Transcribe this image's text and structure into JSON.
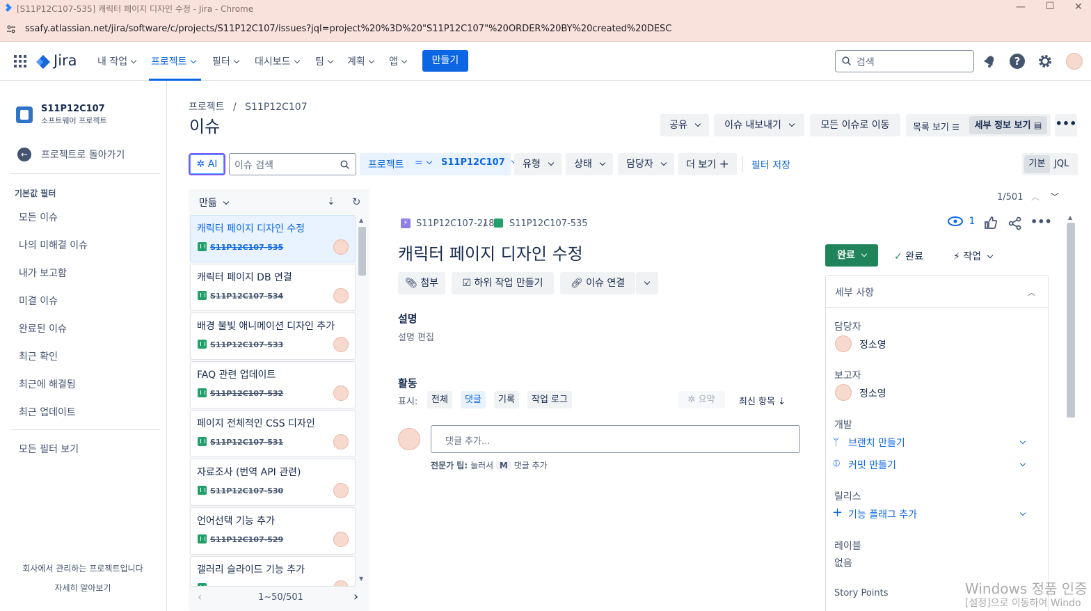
{
  "browser": {
    "title": "[S11P12C107-535] 캐릭터 페이지 디자인 수정 - Jira - Chrome",
    "url": "ssafy.atlassian.net/jira/software/c/projects/S11P12C107/issues?jql=project%20%3D%20\"S11P12C107\"%20ORDER%20BY%20created%20DESC"
  },
  "topnav": {
    "logo": "Jira",
    "items": [
      "내 작업",
      "프로젝트",
      "필터",
      "대시보드",
      "팀",
      "계획",
      "앱"
    ],
    "create": "만들기",
    "search_placeholder": "검색"
  },
  "sidebar": {
    "project_name": "S11P12C107",
    "project_type": "소프트웨어 프로젝트",
    "back": "프로젝트로 돌아가기",
    "filters_heading": "기본값 필터",
    "filters": [
      "모든 이슈",
      "나의 미해결 이슈",
      "내가 보고함",
      "미결 이슈",
      "완료된 이슈",
      "최근 확인",
      "최근에 해결됨",
      "최근 업데이트"
    ],
    "all_filters": "모든 필터 보기",
    "footer_note": "회사에서 관리하는 프로젝트입니다",
    "footer_link": "자세히 알아보기"
  },
  "header": {
    "breadcrumb_root": "프로젝트",
    "breadcrumb_sep": "/",
    "breadcrumb_project": "S11P12C107",
    "title": "이슈",
    "share": "공유",
    "export": "이슈 내보내기",
    "goto_all": "모든 이슈로 이동",
    "list_view": "목록 보기",
    "detail_view": "세부 정보 보기"
  },
  "filterbar": {
    "ai": "AI",
    "search_placeholder": "이슈 검색",
    "project_label": "프로젝트",
    "operator": "=",
    "project_value": "S11P12C107",
    "type": "유형",
    "status": "상태",
    "assignee": "담당자",
    "more": "더 보기",
    "save": "필터 저장",
    "basic": "기본",
    "jql": "JQL"
  },
  "list": {
    "sort_label": "만듦",
    "pagination": "1~50/501",
    "items": [
      {
        "title": "캐릭터 페이지 디자인 수정",
        "key": "S11P12C107-535"
      },
      {
        "title": "캐릭터 페이지 DB 연결",
        "key": "S11P12C107-534"
      },
      {
        "title": "배경 불빛 애니메이션 디자인 추가",
        "key": "S11P12C107-533"
      },
      {
        "title": "FAQ 관련 업데이트",
        "key": "S11P12C107-532"
      },
      {
        "title": "페이지 전체적인 CSS 디자인",
        "key": "S11P12C107-531"
      },
      {
        "title": "자료조사 (번역 API 관련)",
        "key": "S11P12C107-530"
      },
      {
        "title": "언어선택 기능 추가",
        "key": "S11P12C107-529"
      },
      {
        "title": "갤러리 슬라이드 기능 추가",
        "key": ""
      }
    ]
  },
  "detail": {
    "counter": "1/501",
    "parent_key": "S11P12C107-218",
    "issue_key": "S11P12C107-535",
    "watchers": "1",
    "title": "캐릭터 페이지 디자인 수정",
    "attach": "첨부",
    "subtask": "하위 작업 만들기",
    "link_issue": "이슈 연결",
    "desc_heading": "설명",
    "desc_edit": "설명 편집",
    "activity_heading": "활동",
    "show_label": "표시:",
    "act_all": "전체",
    "act_comments": "댓글",
    "act_history": "기록",
    "act_worklog": "작업 로그",
    "summarize": "요약",
    "newest": "최신 항목",
    "comment_placeholder": "댓글 추가...",
    "tip_prefix": "전문가 팁:",
    "tip_middle": "눌러서",
    "tip_key": "M",
    "tip_suffix": "댓글 추가",
    "status": "완료",
    "resolution": "완료",
    "action": "작업",
    "details_heading": "세부 사항",
    "assignee_label": "담당자",
    "assignee": "정소영",
    "reporter_label": "보고자",
    "reporter": "정소영",
    "dev_label": "개발",
    "create_branch": "브랜치 만들기",
    "create_commit": "커밋 만들기",
    "release_label": "릴리스",
    "add_flag": "기능 플래그 추가",
    "labels_label": "레이블",
    "labels_value": "없음",
    "story_points_label": "Story Points"
  },
  "watermark": {
    "line1": "Windows 정품 인증",
    "line2": "[설정]으로 이동하여 Windo"
  },
  "colors": {
    "primary": "#0C66E4",
    "success": "#1F845A",
    "story": "#22A06B",
    "subtask_parent": "#8F7EE7"
  }
}
